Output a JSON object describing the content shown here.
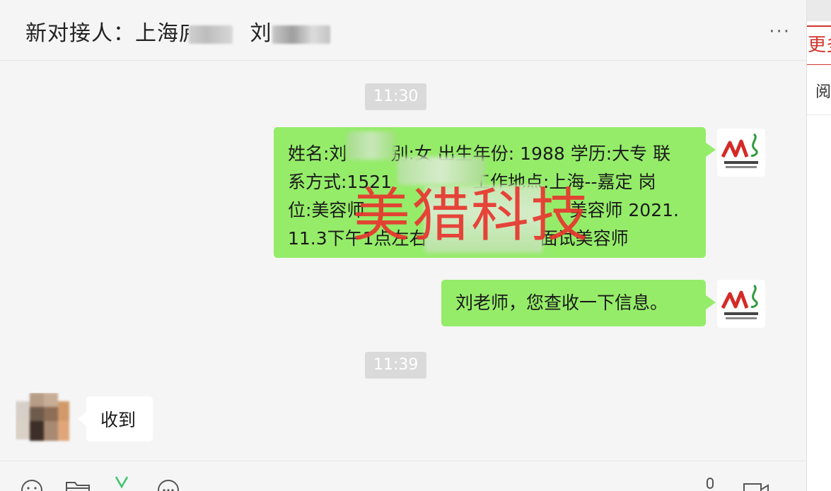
{
  "header": {
    "title_prefix": "新对接人：上海",
    "title_frag": "庐",
    "title_name": "刘",
    "more_glyph": "···"
  },
  "timestamps": [
    "11:30",
    "11:39"
  ],
  "messages": {
    "info_line1_a": "姓名:刘",
    "info_line1_b": "别:女 出生年份: 1988 学历:大专 联",
    "info_line2_a": "系方式:1521",
    "info_line2_b": "工作地点:上海--嘉定 岗",
    "info_line3_a": "位:美容师",
    "info_line3_b": "美容师 2021.",
    "info_line4_a": "11.3下午1点左右",
    "info_line4_b": "面试美容师",
    "notice": "刘老师，您查收一下信息。",
    "reply": "收到"
  },
  "watermark": "美猎科技",
  "side": {
    "more_label": "更多",
    "read_label": "阅"
  },
  "colors": {
    "sent_bubble": "#95ec69",
    "recv_bubble": "#ffffff",
    "watermark": "#e8352e",
    "side_accent": "#d0342c"
  },
  "icons": {
    "toolbar": [
      "emoji-icon",
      "folder-icon",
      "scissors-icon",
      "chat-history-icon",
      "microphone-icon",
      "video-call-icon"
    ],
    "avatar_logo": "meilie-logo-icon"
  }
}
